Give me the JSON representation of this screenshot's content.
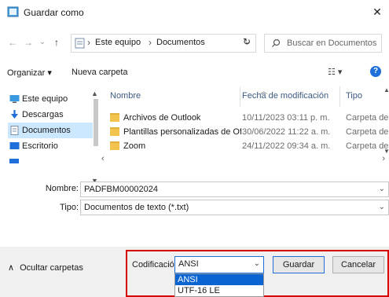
{
  "window": {
    "title": "Guardar como",
    "close_glyph": "✕"
  },
  "nav": {
    "back": "←",
    "forward": "→",
    "dropdown": "⌄",
    "up": "↑",
    "address_segments": [
      "Este equipo",
      "Documentos"
    ],
    "address_sep": "›",
    "address_drop": "⌄",
    "refresh": "↻",
    "search_placeholder": "Buscar en Documentos"
  },
  "toolbar": {
    "organize": "Organizar ▾",
    "new_folder": "Nueva carpeta",
    "view": "☷ ▾",
    "help": "?"
  },
  "sidebar": {
    "items": [
      {
        "label": "Este equipo",
        "icon": "pc-icon"
      },
      {
        "label": "Descargas",
        "icon": "download-icon"
      },
      {
        "label": "Documentos",
        "icon": "documents-icon"
      },
      {
        "label": "Escritorio",
        "icon": "desktop-icon"
      }
    ],
    "selected_index": 2
  },
  "list": {
    "columns": [
      "Nombre",
      "Fecha de modificación",
      "Tipo"
    ],
    "rows": [
      {
        "name": "Archivos de Outlook",
        "date": "10/11/2023 03:11 p. m.",
        "type": "Carpeta de"
      },
      {
        "name": "Plantillas personalizadas de Office",
        "date": "30/06/2022 11:22 a. m.",
        "type": "Carpeta de"
      },
      {
        "name": "Zoom",
        "date": "24/11/2022 09:34 a. m.",
        "type": "Carpeta de"
      }
    ]
  },
  "form": {
    "name_label": "Nombre:",
    "name_value": "PADFBM00002024",
    "type_label": "Tipo:",
    "type_value": "Documentos de texto (*.txt)"
  },
  "footer": {
    "hide_folders": "Ocultar carpetas",
    "hide_chevron": "∧",
    "encoding_label": "Codificación:",
    "encoding_value": "ANSI",
    "encoding_options": [
      "ANSI",
      "UTF-16 LE"
    ],
    "encoding_selected_index": 0,
    "save_label": "Guardar",
    "cancel_label": "Cancelar"
  },
  "colors": {
    "accent": "#1e6fd9",
    "selection": "#cce8ff",
    "highlight_box": "#d40000",
    "folder": "#f3c44d"
  }
}
